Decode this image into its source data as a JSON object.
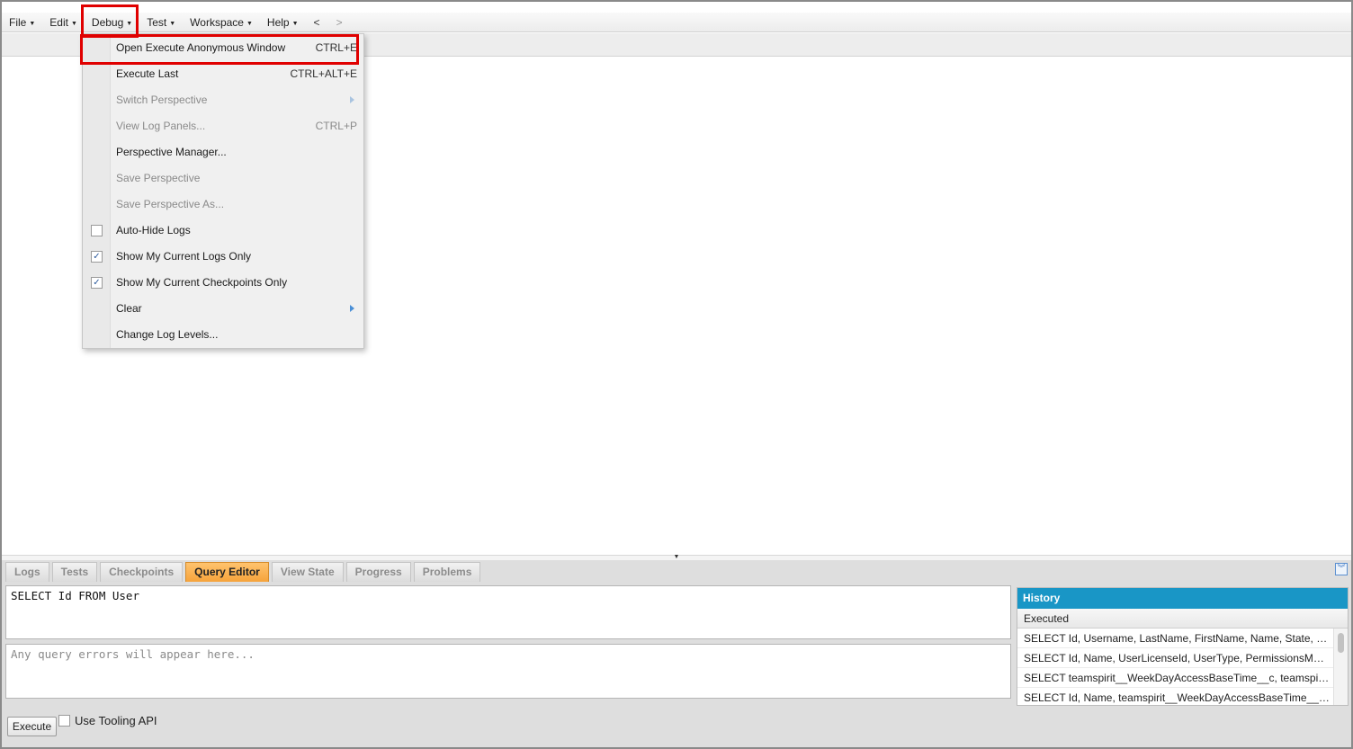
{
  "menubar": {
    "items": [
      {
        "label": "File"
      },
      {
        "label": "Edit"
      },
      {
        "label": "Debug"
      },
      {
        "label": "Test"
      },
      {
        "label": "Workspace"
      },
      {
        "label": "Help"
      }
    ],
    "nav_back": "<",
    "nav_forward": ">"
  },
  "debug_menu": {
    "items": [
      {
        "label": "Open Execute Anonymous Window",
        "shortcut": "CTRL+E"
      },
      {
        "label": "Execute Last",
        "shortcut": "CTRL+ALT+E"
      },
      {
        "label": "Switch Perspective",
        "disabled": true,
        "submenu": true
      },
      {
        "label": "View Log Panels...",
        "shortcut": "CTRL+P",
        "disabled": true
      },
      {
        "label": "Perspective Manager..."
      },
      {
        "label": "Save Perspective",
        "disabled": true
      },
      {
        "label": "Save Perspective As...",
        "disabled": true
      },
      {
        "label": "Auto-Hide Logs",
        "checked": false
      },
      {
        "label": "Show My Current Logs Only",
        "checked": true
      },
      {
        "label": "Show My Current Checkpoints Only",
        "checked": true
      },
      {
        "label": "Clear",
        "submenu": true
      },
      {
        "label": "Change Log Levels..."
      }
    ]
  },
  "bottom_panel": {
    "tabs": [
      {
        "label": "Logs"
      },
      {
        "label": "Tests"
      },
      {
        "label": "Checkpoints"
      },
      {
        "label": "Query Editor",
        "active": true
      },
      {
        "label": "View State"
      },
      {
        "label": "Progress"
      },
      {
        "label": "Problems"
      }
    ],
    "query_text": "SELECT Id FROM User",
    "error_placeholder": "Any query errors will appear here...",
    "execute_label": "Execute",
    "tooling_label": "Use Tooling API",
    "tooling_checked": false
  },
  "history": {
    "title": "History",
    "column": "Executed",
    "rows": [
      "SELECT Id, Username, LastName, FirstName, Name, State, IsActi...",
      "SELECT Id, Name, UserLicenseId, UserType, PermissionsModifyAl...",
      "SELECT teamspirit__WeekDayAccessBaseTime__c, teamspirit__H...",
      "SELECT Id, Name, teamspirit__WeekDayAccessBaseTime__c, tea..."
    ]
  },
  "colors": {
    "highlight": "#e00000",
    "active_tab": "#f6a33a",
    "history_header": "#1996c6"
  }
}
